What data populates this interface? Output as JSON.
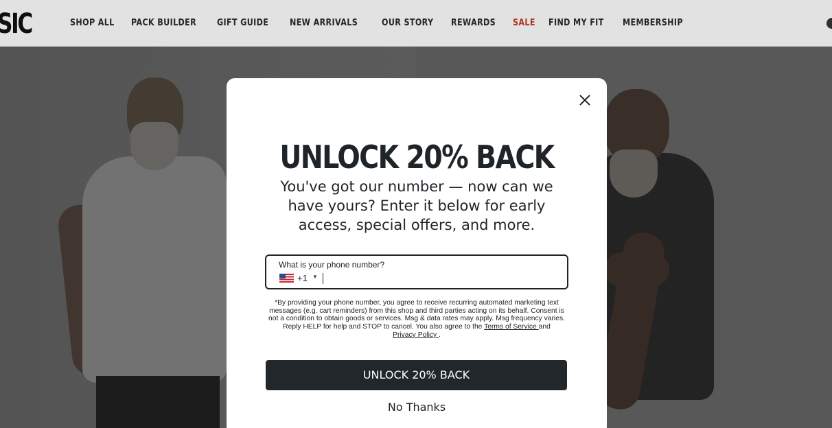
{
  "header": {
    "logo_text": "SIC",
    "nav": [
      {
        "label": "SHOP ALL"
      },
      {
        "label": "PACK BUILDER"
      },
      {
        "label": "GIFT GUIDE"
      },
      {
        "label": "NEW ARRIVALS"
      },
      {
        "label": "OUR STORY"
      },
      {
        "label": "REWARDS"
      },
      {
        "label": "SALE",
        "color": "#c0392b"
      },
      {
        "label": "FIND MY FIT"
      },
      {
        "label": "MEMBERSHIP"
      }
    ]
  },
  "modal": {
    "title": "UNLOCK 20% BACK",
    "subtitle": "You've got our number — now can we have yours? Enter it below for early access, special offers, and more.",
    "phone": {
      "label": "What is your phone number?",
      "country_code": "+1",
      "flag": "us-flag-icon",
      "value": ""
    },
    "consent": {
      "text": "*By providing your phone number, you agree to receive recurring automated marketing text messages (e.g. cart reminders) from this shop and third parties acting on its behalf. Consent is not a condition to obtain goods or services. Msg & data rates may apply. Msg frequency varies. Reply HELP for help and STOP to cancel. You also agree to the",
      "terms_link": "Terms of Service ",
      "and": "and",
      "privacy_link": "Privacy Policy ",
      "end": "."
    },
    "submit_label": "UNLOCK 20% BACK",
    "dismiss_label": "No Thanks"
  },
  "colors": {
    "sale": "#c0392b",
    "button_bg": "#22272b",
    "text": "#1f2429"
  }
}
